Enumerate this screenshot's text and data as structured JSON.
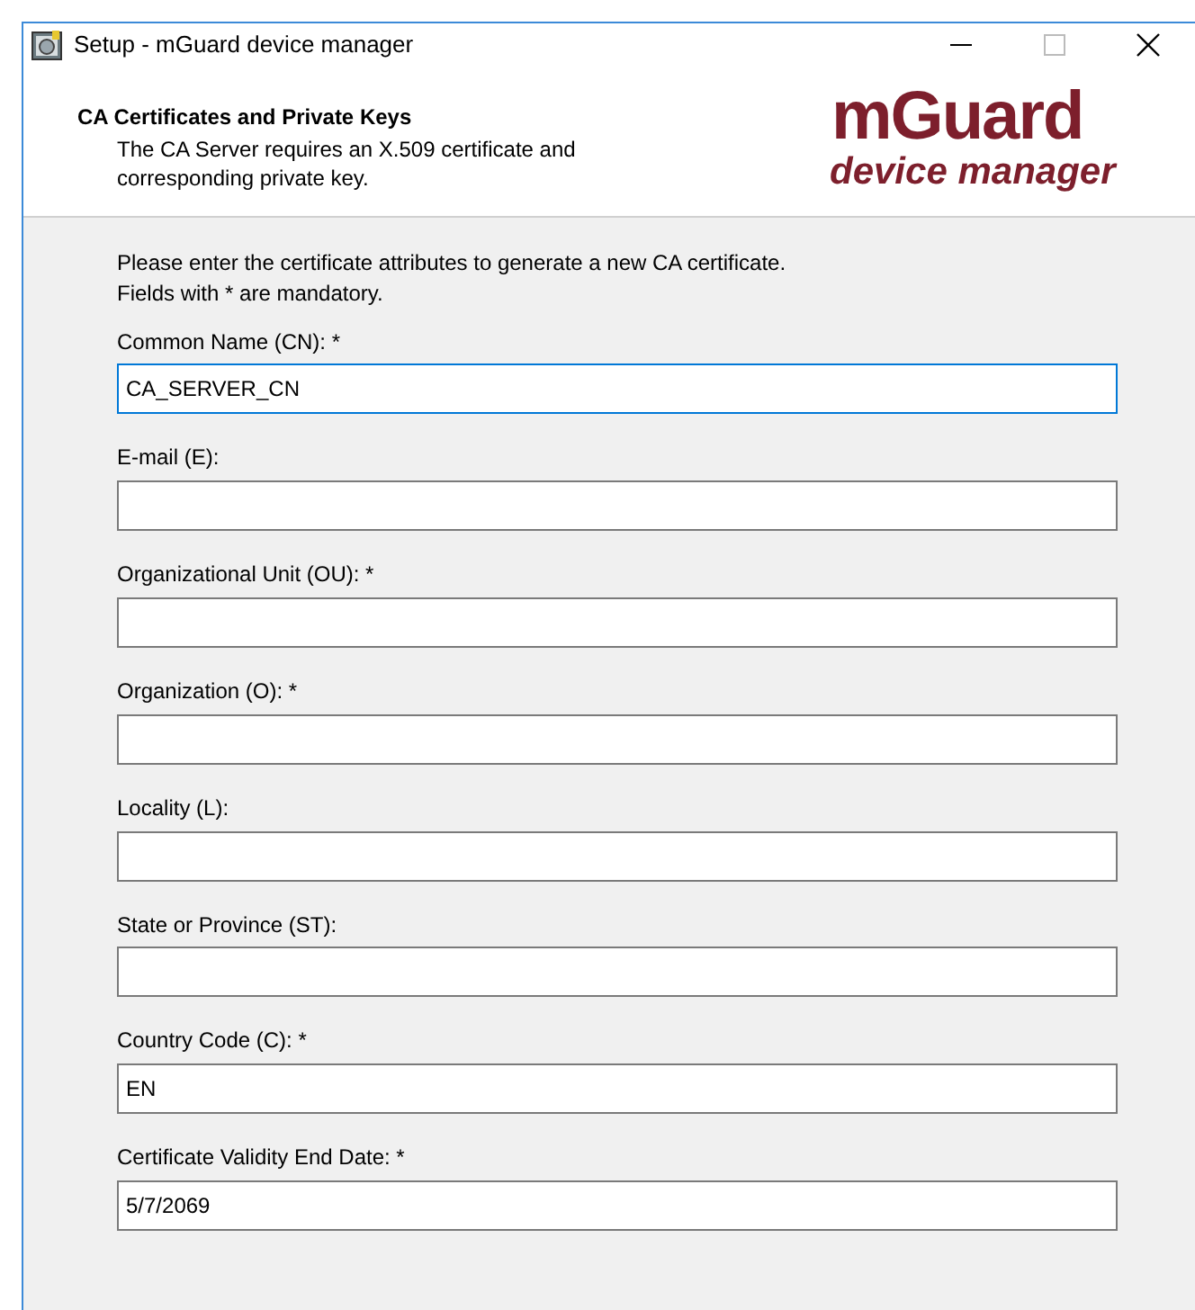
{
  "window": {
    "title": "Setup - mGuard device manager"
  },
  "header": {
    "title": "CA Certificates and Private Keys",
    "subtitle": "The CA Server requires an X.509 certificate and corresponding private key.",
    "logo": {
      "brand": "mGuard",
      "tagline": "device manager"
    }
  },
  "intro": [
    "Please enter the certificate attributes to generate a new CA certificate.",
    "Fields with * are mandatory."
  ],
  "fields": [
    {
      "label": "Common Name (CN): *",
      "value": "CA_SERVER_CN",
      "focused": true
    },
    {
      "label": "E-mail (E):",
      "focused": false
    },
    {
      "label": "Organizational Unit (OU): *",
      "focused": false
    },
    {
      "label": "Organization (O): *",
      "focused": false
    },
    {
      "label": "Locality (L):",
      "focused": false
    },
    {
      "label": "State or Province (ST):",
      "focused": false
    },
    {
      "label": "Country Code (C): *",
      "value": "EN",
      "focused": false
    },
    {
      "label": "Certificate Validity End Date: *",
      "value": "5/7/2069",
      "focused": false
    }
  ]
}
